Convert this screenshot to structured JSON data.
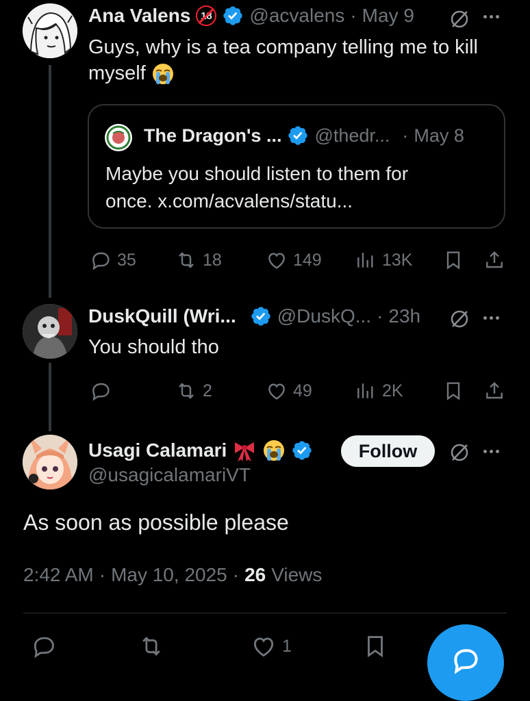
{
  "thread": {
    "post1": {
      "name": "Ana Valens",
      "age_badge": "18",
      "handle": "@acvalens",
      "sep": "·",
      "date": "May 9",
      "text": "Guys, why is a tea company telling me to kill myself",
      "emoji": "loudly-crying-face",
      "quote": {
        "name": "The Dragon's ...",
        "handle": "@thedr...",
        "sep": "·",
        "date": "May 8",
        "text_line1": "Maybe you should listen to them for",
        "text_line2": "once. x.com/acvalens/statu..."
      },
      "replies": "35",
      "reposts": "18",
      "likes": "149",
      "views": "13K"
    },
    "post2": {
      "name": "DuskQuill (Wri...",
      "handle": "@DuskQ...",
      "sep": "·",
      "date": "23h",
      "text": "You should tho",
      "reposts": "2",
      "likes": "49",
      "views": "2K"
    },
    "main": {
      "name": "Usagi Calamari",
      "handle": "@usagicalamariVT",
      "follow_label": "Follow",
      "text": "As soon as possible please",
      "time": "2:42 AM",
      "dot1": "·",
      "date": "May 10, 2025",
      "dot2": "·",
      "views_count": "26",
      "views_label": "Views",
      "bottom_likes": "1"
    }
  },
  "colors": {
    "background": "#000000",
    "text": "#e7e9ea",
    "muted": "#71767b",
    "verified": "#1d9bf0",
    "fab": "#1d9bf0",
    "border": "#2f3336"
  }
}
